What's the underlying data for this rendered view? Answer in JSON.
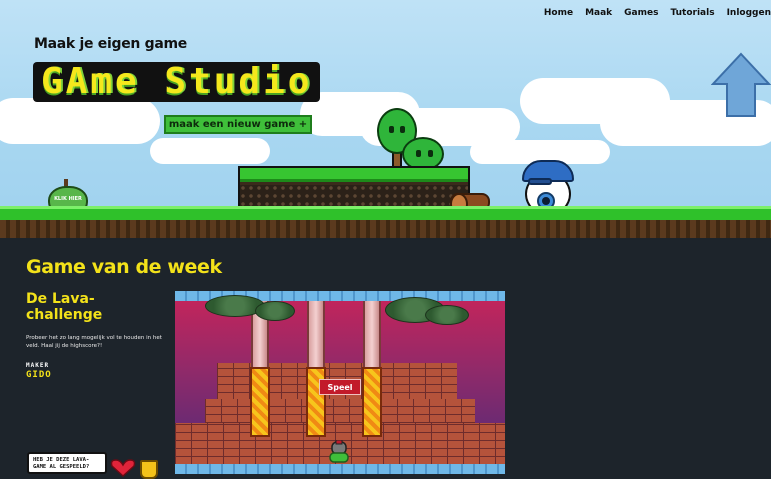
{
  "nav": {
    "items": [
      "Home",
      "Maak",
      "Games",
      "Tutorials",
      "Inloggen"
    ]
  },
  "hero": {
    "tagline": "Maak je eigen game",
    "logo": "GAme Studio",
    "new_game_button": "maak een nieuw game  +",
    "apple_text": "KLIK HIER"
  },
  "game_of_week": {
    "heading": "Game van de week",
    "title": "De Lava-challenge",
    "description": "Probeer het zo lang mogelijk vol te houden in het veld. Haal jij de highscore?!",
    "maker_label": "MAKER",
    "maker_name": "GIDO",
    "play_button": "Speel",
    "bubble_text": "HEB JE DEZE LAVA-GAME AL GESPEELD?"
  },
  "colors": {
    "accent_yellow": "#f3e21a",
    "grass_green": "#2fc12a",
    "dark_bg": "#1d242b",
    "play_red": "#c21a2a",
    "arrow_blue": "#6fa6d8"
  },
  "icons": [
    "arrow-up-icon",
    "heart-icon",
    "trophy-icon",
    "apple-icon"
  ]
}
